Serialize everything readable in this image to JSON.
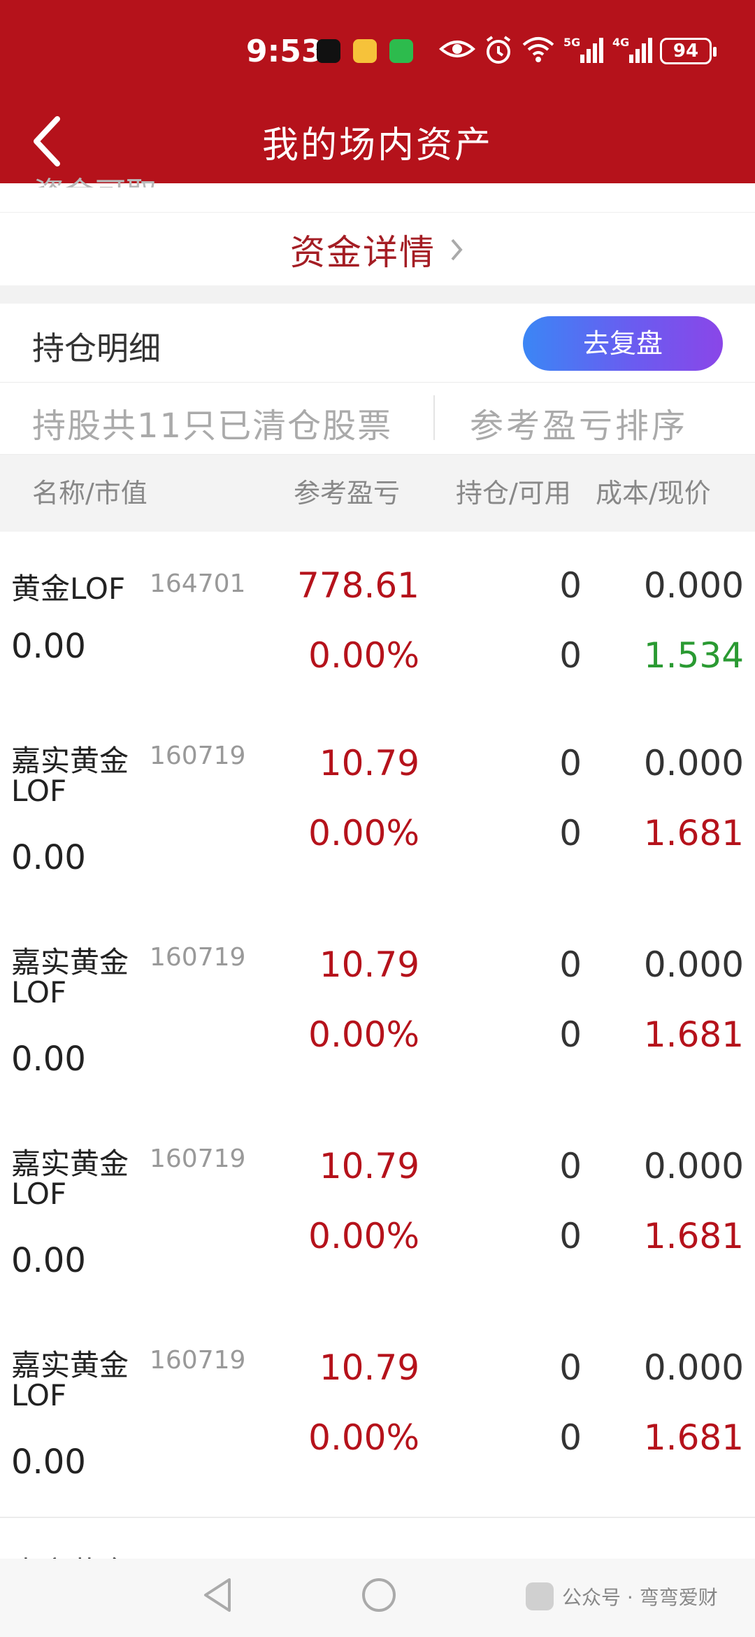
{
  "status_bar": {
    "time": "9:53",
    "battery": "94",
    "signal_5g": "5G",
    "signal_4g": "4G"
  },
  "header": {
    "title": "我的场内资产"
  },
  "fund_detail": {
    "label": "资金详情"
  },
  "holdings_section": {
    "title": "持仓明细",
    "review_button": "去复盘"
  },
  "tabs": {
    "cleared": "持股共11只已清仓股票",
    "sort": "参考盈亏排序"
  },
  "columns": {
    "name": "名称/市值",
    "pl": "参考盈亏",
    "hold": "持仓/可用",
    "cost": "成本/现价"
  },
  "rows": [
    {
      "name": "黄金LOF",
      "code": "164701",
      "market_value": "0.00",
      "pl": "778.61",
      "pl_pct": "0.00%",
      "hold": "0",
      "avail": "0",
      "cost": "0.000",
      "price": "1.534",
      "price_dir": "down"
    },
    {
      "name": "嘉实黄金",
      "name2": "LOF",
      "code": "160719",
      "market_value": "0.00",
      "pl": "10.79",
      "pl_pct": "0.00%",
      "hold": "0",
      "avail": "0",
      "cost": "0.000",
      "price": "1.681",
      "price_dir": "up"
    },
    {
      "name": "嘉实黄金",
      "name2": "LOF",
      "code": "160719",
      "market_value": "0.00",
      "pl": "10.79",
      "pl_pct": "0.00%",
      "hold": "0",
      "avail": "0",
      "cost": "0.000",
      "price": "1.681",
      "price_dir": "up"
    },
    {
      "name": "嘉实黄金",
      "name2": "LOF",
      "code": "160719",
      "market_value": "0.00",
      "pl": "10.79",
      "pl_pct": "0.00%",
      "hold": "0",
      "avail": "0",
      "cost": "0.000",
      "price": "1.681",
      "price_dir": "up"
    },
    {
      "name": "嘉实黄金",
      "name2": "LOF",
      "code": "160719",
      "market_value": "0.00",
      "pl": "10.79",
      "pl_pct": "0.00%",
      "hold": "0",
      "avail": "0",
      "cost": "0.000",
      "price": "1.681",
      "price_dir": "up"
    }
  ],
  "watermark": {
    "text": "公众号 · 弯弯爱财"
  },
  "colors": {
    "header_bg": "#b5121b",
    "gain": "#b5121b",
    "loss": "#2a9a32",
    "accent_text": "#a41d24"
  }
}
